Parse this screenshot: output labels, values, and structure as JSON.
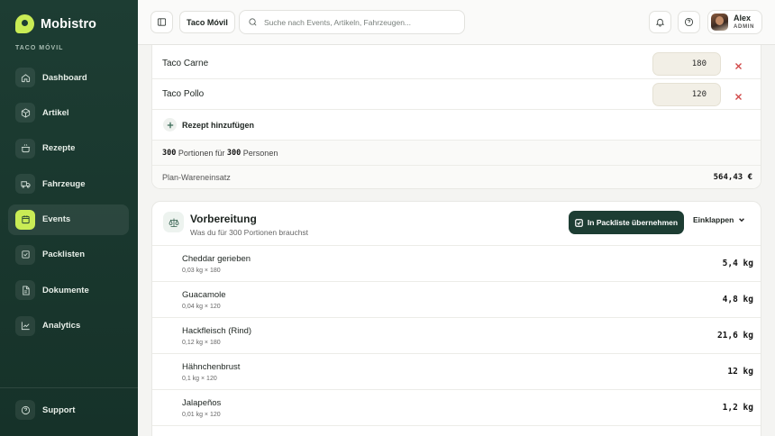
{
  "sidebar": {
    "brand": "Mobistro",
    "workspace": "TACO MÓVIL",
    "items": [
      {
        "label": "Dashboard",
        "icon": "home-icon"
      },
      {
        "label": "Artikel",
        "icon": "package-icon"
      },
      {
        "label": "Rezepte",
        "icon": "pot-icon"
      },
      {
        "label": "Fahrzeuge",
        "icon": "truck-icon"
      },
      {
        "label": "Events",
        "icon": "calendar-icon",
        "active": true
      },
      {
        "label": "Packlisten",
        "icon": "checklist-icon"
      },
      {
        "label": "Dokumente",
        "icon": "document-icon"
      },
      {
        "label": "Analytics",
        "icon": "chart-icon"
      }
    ],
    "support": "Support"
  },
  "topbar": {
    "breadcrumb": "Taco Móvil",
    "search_placeholder": "Suche nach Events, Artikeln, Fahrzeugen...",
    "user_name": "Alex",
    "user_role": "ADMIN"
  },
  "recipes": {
    "rows": [
      {
        "name": "Taco Carne",
        "qty": "180"
      },
      {
        "name": "Taco Pollo",
        "qty": "120"
      }
    ],
    "add_label": "Rezept hinzufügen",
    "portions": "300",
    "portions_label": "Portionen für",
    "persons": "300",
    "persons_label": "Personen",
    "cost_label": "Plan-Wareneinsatz",
    "cost_value": "564,43 €"
  },
  "prep": {
    "title": "Vorbereitung",
    "subtitle": "Was du für 300 Portionen brauchst",
    "primary_button": "In Packliste übernehmen",
    "collapse_button": "Einklappen",
    "items": [
      {
        "name": "Cheddar gerieben",
        "formula": "0,03 kg × 180",
        "total": "5,4 kg"
      },
      {
        "name": "Guacamole",
        "formula": "0,04 kg × 120",
        "total": "4,8 kg"
      },
      {
        "name": "Hackfleisch (Rind)",
        "formula": "0,12 kg × 180",
        "total": "21,6 kg"
      },
      {
        "name": "Hähnchenbrust",
        "formula": "0,1 kg × 120",
        "total": "12 kg"
      },
      {
        "name": "Jalapeños",
        "formula": "0,01 kg × 120",
        "total": "1,2 kg"
      }
    ]
  },
  "colors": {
    "sidebar_bg": "#1d3d33",
    "accent": "#c9ec55",
    "danger": "#d04545"
  }
}
